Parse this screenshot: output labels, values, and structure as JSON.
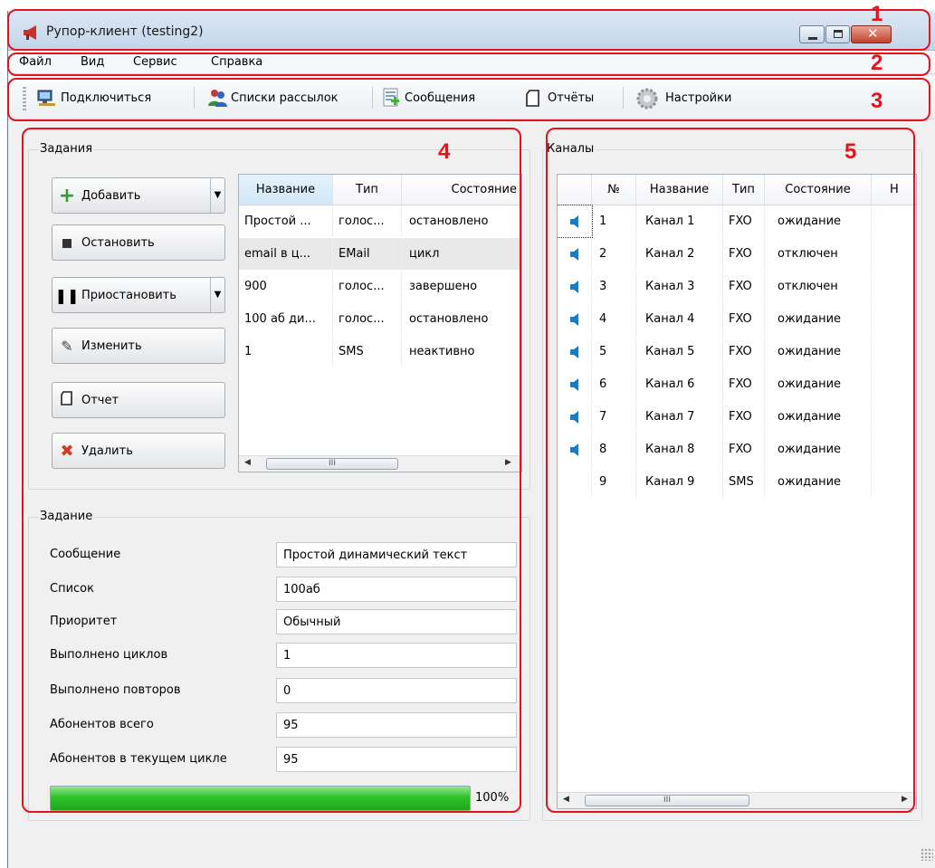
{
  "window": {
    "title": "Рупор-клиент (testing2)",
    "controls": [
      "minimize-icon",
      "maximize-icon",
      "close-icon"
    ]
  },
  "menu": {
    "items": [
      "Файл",
      "Вид",
      "Сервис",
      "Справка"
    ]
  },
  "toolbar": {
    "buttons": [
      {
        "label": "Подключиться",
        "icon": "connect-icon"
      },
      {
        "label": "Списки рассылок",
        "icon": "users-icon"
      },
      {
        "label": "Сообщения",
        "icon": "messages-icon"
      },
      {
        "label": "Отчёты",
        "icon": "report-icon"
      },
      {
        "label": "Настройки",
        "icon": "gear-icon"
      }
    ]
  },
  "tasks": {
    "title": "Задания",
    "buttons": [
      {
        "label": "Добавить",
        "icon": "plus-icon"
      },
      {
        "label": "Остановить",
        "icon": "stop-icon"
      },
      {
        "label": "Приостановить",
        "icon": "pause-icon"
      },
      {
        "label": "Изменить",
        "icon": "pencil-icon"
      },
      {
        "label": "Отчет",
        "icon": "report-icon"
      },
      {
        "label": "Удалить",
        "icon": "delete-icon"
      }
    ],
    "columns": [
      "Название",
      "Тип",
      "Состояние"
    ],
    "rows": [
      [
        "Простой ...",
        "голос...",
        "остановлено"
      ],
      [
        "email в ц...",
        "EMail",
        "цикл"
      ],
      [
        "900",
        "голос...",
        "завершено"
      ],
      [
        "100 аб ди...",
        "голос...",
        "остановлено"
      ],
      [
        "1",
        "SMS",
        "неактивно"
      ]
    ],
    "scroll_glyph": "III"
  },
  "task": {
    "title": "Задание",
    "fields": [
      {
        "label": "Сообщение",
        "value": "Простой динамический текст"
      },
      {
        "label": "Список",
        "value": "100аб"
      },
      {
        "label": "Приоритет",
        "value": "Обычный"
      },
      {
        "label": "Выполнено циклов",
        "value": "1"
      },
      {
        "label": "Выполнено повторов",
        "value": "0"
      },
      {
        "label": "Абонентов всего",
        "value": "95"
      },
      {
        "label": "Абонентов в текущем цикле",
        "value": "95"
      }
    ],
    "progress": 1.0,
    "progress_label": "100%"
  },
  "channels": {
    "title": "Каналы",
    "columns": [
      "№",
      "Название",
      "Тип",
      "Состояние",
      "Н"
    ],
    "rows": [
      [
        "1",
        "Канал 1",
        "FXO",
        "ожидание"
      ],
      [
        "2",
        "Канал 2",
        "FXO",
        "отключен"
      ],
      [
        "3",
        "Канал 3",
        "FXO",
        "отключен"
      ],
      [
        "4",
        "Канал 4",
        "FXO",
        "ожидание"
      ],
      [
        "5",
        "Канал 5",
        "FXO",
        "ожидание"
      ],
      [
        "6",
        "Канал 6",
        "FXO",
        "ожидание"
      ],
      [
        "7",
        "Канал 7",
        "FXO",
        "ожидание"
      ],
      [
        "8",
        "Канал 8",
        "FXO",
        "ожидание"
      ],
      [
        "9",
        "Канал 9",
        "SMS",
        "ожидание"
      ]
    ],
    "scroll_glyph": "III"
  },
  "annotations": [
    "1",
    "2",
    "3",
    "4",
    "5"
  ],
  "colors": {
    "annotation": "#e3141b",
    "progress": "#2fc12b"
  }
}
